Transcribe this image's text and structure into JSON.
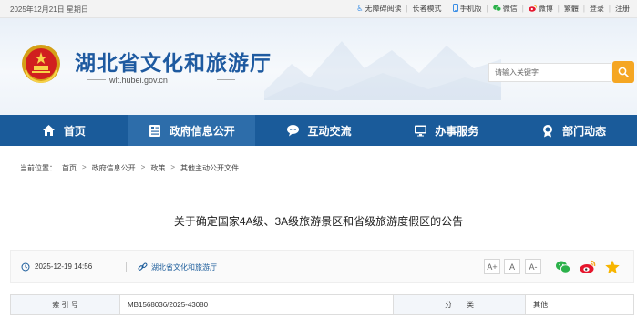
{
  "topbar": {
    "date": "2025年12月21日 星期日",
    "links": [
      {
        "icon": "accessibility-icon",
        "label": "无障碍阅读"
      },
      {
        "icon": "",
        "label": "长者模式"
      },
      {
        "icon": "phone-icon",
        "label": "手机版"
      },
      {
        "icon": "wechat-icon",
        "label": "微信"
      },
      {
        "icon": "weibo-icon",
        "label": "微博"
      },
      {
        "icon": "",
        "label": "繁體"
      },
      {
        "icon": "",
        "label": "登录"
      },
      {
        "icon": "",
        "label": "注册"
      }
    ]
  },
  "header": {
    "site_title": "湖北省文化和旅游厅",
    "site_domain": "wlt.hubei.gov.cn",
    "search_placeholder": "请输入关键字"
  },
  "nav": [
    {
      "icon": "home-icon",
      "label": "首页"
    },
    {
      "icon": "document-icon",
      "label": "政府信息公开"
    },
    {
      "icon": "chat-icon",
      "label": "互动交流"
    },
    {
      "icon": "monitor-icon",
      "label": "办事服务"
    },
    {
      "icon": "badge-icon",
      "label": "部门动态"
    }
  ],
  "breadcrumb": {
    "prefix": "当前位置：",
    "items": [
      "首页",
      "政府信息公开",
      "政策",
      "其他主动公开文件"
    ],
    "separator": ">"
  },
  "article": {
    "title": "关于确定国家4A级、3A级旅游景区和省级旅游度假区的公告",
    "date": "2025-12-19 14:56",
    "source": "湖北省文化和旅游厅",
    "font_sizes": [
      "A+",
      "A",
      "A-"
    ]
  },
  "info_table": {
    "index_label": "索 引 号",
    "index_value": "MB1568036/2025-43080",
    "category_label": "分　　类",
    "category_value": "其他"
  },
  "colors": {
    "nav_bg": "#1a5b9a",
    "nav_active": "#2d6daa",
    "title_blue": "#1e5aa0",
    "search_button": "#f5a623"
  }
}
